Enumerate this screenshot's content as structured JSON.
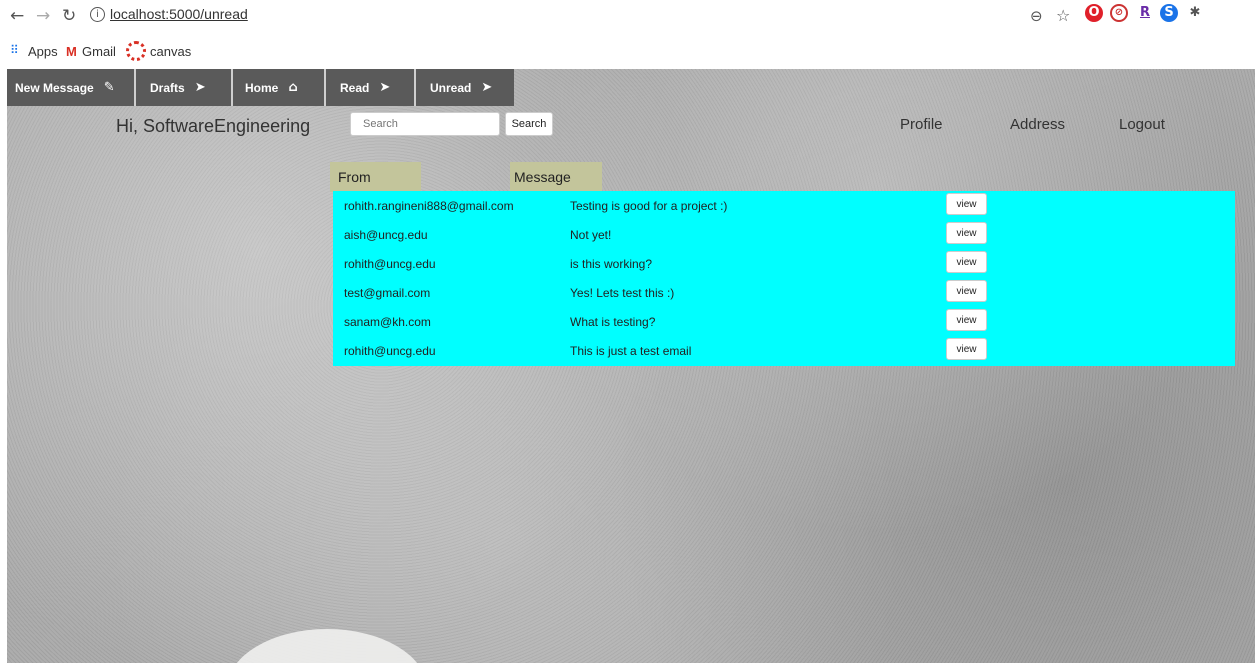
{
  "browser": {
    "url": "localhost:5000/unread",
    "bookmarks": [
      {
        "label": "Apps",
        "icon": "apps-grid-icon"
      },
      {
        "label": "Gmail",
        "icon": "gmail-icon"
      },
      {
        "label": "canvas",
        "icon": "canvas-icon"
      }
    ]
  },
  "nav": {
    "items": [
      {
        "label": "New Message",
        "icon": "pencil-icon"
      },
      {
        "label": "Drafts",
        "icon": "send-icon"
      },
      {
        "label": "Home",
        "icon": "home-icon"
      },
      {
        "label": "Read",
        "icon": "send-icon"
      },
      {
        "label": "Unread",
        "icon": "send-icon"
      }
    ]
  },
  "header": {
    "greeting": "Hi, SoftwareEngineering",
    "search_placeholder": "Search",
    "search_button": "Search",
    "links": [
      "Profile",
      "Address",
      "Logout"
    ]
  },
  "table": {
    "headers": [
      "From",
      "Message"
    ],
    "view_label": "view",
    "rows": [
      {
        "from": "rohith.rangineni888@gmail.com",
        "message": "Testing is good for a project :)"
      },
      {
        "from": "aish@uncg.edu",
        "message": "Not yet!"
      },
      {
        "from": "rohith@uncg.edu",
        "message": "is this working?"
      },
      {
        "from": "test@gmail.com",
        "message": "Yes! Lets test this :)"
      },
      {
        "from": "sanam@kh.com",
        "message": "What is testing?"
      },
      {
        "from": "rohith@uncg.edu",
        "message": "This is just a test email"
      }
    ]
  },
  "colors": {
    "table_bg": "#00ffff",
    "header_bg": "#c3c59b",
    "navbar_bg": "#5a5a5a"
  }
}
